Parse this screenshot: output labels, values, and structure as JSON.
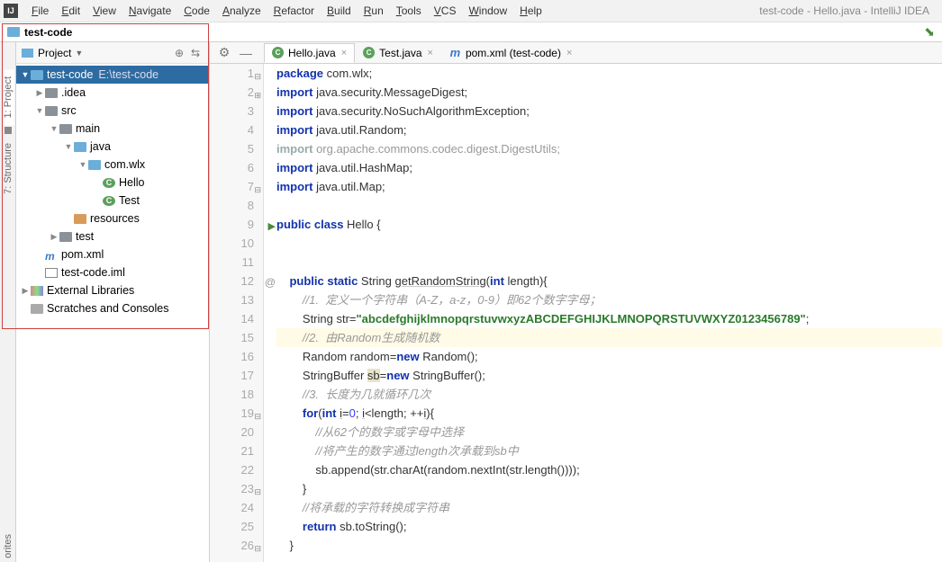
{
  "app_title": "test-code - Hello.java - IntelliJ IDEA",
  "menu": [
    "File",
    "Edit",
    "View",
    "Navigate",
    "Code",
    "Analyze",
    "Refactor",
    "Build",
    "Run",
    "Tools",
    "VCS",
    "Window",
    "Help"
  ],
  "breadcrumb": {
    "project": "test-code"
  },
  "sidebar": {
    "title": "Project",
    "tree": [
      {
        "depth": 0,
        "arrow": "▼",
        "icon": "folder-blue",
        "label": "test-code",
        "hint": "E:\\test-code",
        "sel": true
      },
      {
        "depth": 1,
        "arrow": "▶",
        "icon": "folder",
        "label": ".idea"
      },
      {
        "depth": 1,
        "arrow": "▼",
        "icon": "folder",
        "label": "src"
      },
      {
        "depth": 2,
        "arrow": "▼",
        "icon": "folder",
        "label": "main"
      },
      {
        "depth": 3,
        "arrow": "▼",
        "icon": "folder-blue",
        "label": "java"
      },
      {
        "depth": 4,
        "arrow": "▼",
        "icon": "folder-blue",
        "label": "com.wlx"
      },
      {
        "depth": 5,
        "arrow": "",
        "icon": "class",
        "label": "Hello"
      },
      {
        "depth": 5,
        "arrow": "",
        "icon": "class",
        "label": "Test"
      },
      {
        "depth": 3,
        "arrow": "",
        "icon": "folder-orange",
        "label": "resources"
      },
      {
        "depth": 2,
        "arrow": "▶",
        "icon": "folder",
        "label": "test"
      },
      {
        "depth": 1,
        "arrow": "",
        "icon": "maven",
        "label": "pom.xml"
      },
      {
        "depth": 1,
        "arrow": "",
        "icon": "iml",
        "label": "test-code.iml"
      },
      {
        "depth": 0,
        "arrow": "▶",
        "icon": "lib",
        "label": "External Libraries"
      },
      {
        "depth": 0,
        "arrow": "",
        "icon": "scratch",
        "label": "Scratches and Consoles"
      }
    ]
  },
  "tabs": [
    {
      "label": "Hello.java",
      "icon": "class",
      "active": true
    },
    {
      "label": "Test.java",
      "icon": "class",
      "active": false
    },
    {
      "label": "pom.xml (test-code)",
      "icon": "maven",
      "active": false
    }
  ],
  "left_tool_tabs": [
    "1: Project",
    "7: Structure"
  ],
  "bottom_tool_tab": "orites",
  "code": {
    "lines": [
      {
        "n": 1,
        "fold": "-",
        "html": "<span class='kw'>package</span> com.wlx;"
      },
      {
        "n": 2,
        "fold": "+",
        "html": "<span class='kw'>import</span> java.security.MessageDigest;"
      },
      {
        "n": 3,
        "html": "<span class='kw'>import</span> java.security.NoSuchAlgorithmException;"
      },
      {
        "n": 4,
        "html": "<span class='kw'>import</span> java.util.Random;"
      },
      {
        "n": 5,
        "html": "<span class='dim kw' style='color:#9aa'>import</span> <span class='dim'>org.apache.commons.codec.digest.DigestUtils;</span>"
      },
      {
        "n": 6,
        "html": "<span class='kw'>import</span> java.util.HashMap;"
      },
      {
        "n": 7,
        "fold": "-",
        "html": "<span class='kw'>import</span> java.util.Map;"
      },
      {
        "n": 8,
        "html": ""
      },
      {
        "n": 9,
        "run": true,
        "fold": "-",
        "html": "<span class='kw'>public class</span> Hello {"
      },
      {
        "n": 10,
        "html": ""
      },
      {
        "n": 11,
        "html": ""
      },
      {
        "n": 12,
        "at": true,
        "fold": "-",
        "html": "    <span class='kw'>public static</span> String <span class='ul'>getRandomString</span>(<span class='kw'>int</span> length){"
      },
      {
        "n": 13,
        "html": "        <span class='cm'>//1.  定义一个字符串（A-Z，a-z，0-9）即62个数字字母；</span>"
      },
      {
        "n": 14,
        "html": "        String str=<span class='str'>\"abcdefghijklmnopqrstuvwxyzABCDEFGHIJKLMNOPQRSTUVWXYZ0123456789\"</span>;"
      },
      {
        "n": 15,
        "hl": true,
        "html": "        <span class='cm'>//2.  由Random生成随机数</span>"
      },
      {
        "n": 16,
        "html": "        Random random=<span class='kw'>new</span> Random();"
      },
      {
        "n": 17,
        "html": "        StringBuffer <span class='hl-ident'>sb</span>=<span class='kw'>new</span> StringBuffer();"
      },
      {
        "n": 18,
        "html": "        <span class='cm'>//3.  长度为几就循环几次</span>"
      },
      {
        "n": 19,
        "fold": "-",
        "html": "        <span class='kw'>for</span>(<span class='kw'>int</span> <span class='ul'>i</span>=<span class='num'>0</span>; <span class='ul'>i</span>&lt;length; ++<span class='ul'>i</span>){"
      },
      {
        "n": 20,
        "html": "            <span class='cm'>//从62个的数字或字母中选择</span>"
      },
      {
        "n": 21,
        "html": "            <span class='cm'>//将产生的数字通过length次承载到sb中</span>"
      },
      {
        "n": 22,
        "html": "            sb.append(str.charAt(random.nextInt(str.length())));"
      },
      {
        "n": 23,
        "fold": "-",
        "html": "        }"
      },
      {
        "n": 24,
        "html": "        <span class='cm'>//将承载的字符转换成字符串</span>"
      },
      {
        "n": 25,
        "html": "        <span class='kw'>return</span> sb.toString();"
      },
      {
        "n": 26,
        "fold": "-",
        "html": "    }"
      }
    ]
  }
}
